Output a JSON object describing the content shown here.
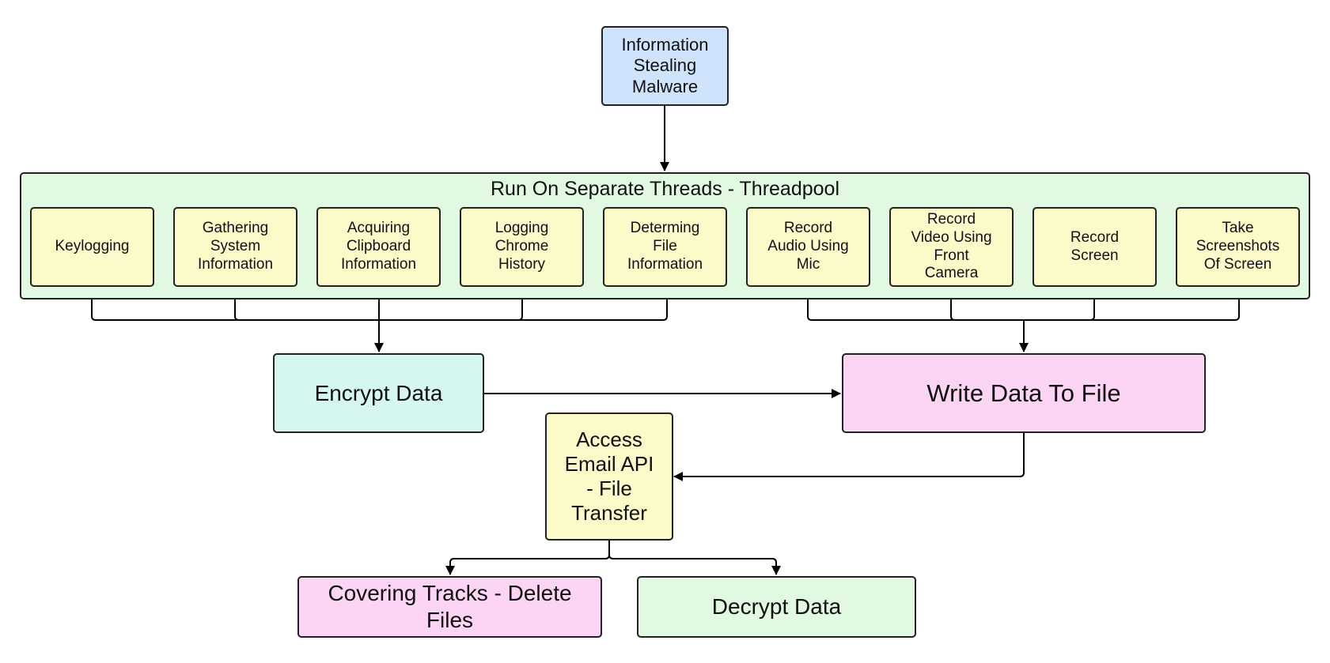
{
  "diagram": {
    "root": {
      "label": "Information\nStealing\nMalware",
      "color": "#cfe3fc"
    },
    "threadpool": {
      "title": "Run On Separate Threads - Threadpool",
      "color": "#e1f9e0",
      "tasks": [
        {
          "label": "Keylogging",
          "target": "encrypt"
        },
        {
          "label": "Gathering\nSystem\nInformation",
          "target": "encrypt"
        },
        {
          "label": "Acquiring\nClipboard\nInformation",
          "target": "encrypt"
        },
        {
          "label": "Logging\nChrome\nHistory",
          "target": "encrypt"
        },
        {
          "label": "Determing\nFile\nInformation",
          "target": "encrypt"
        },
        {
          "label": "Record\nAudio Using\nMic",
          "target": "write"
        },
        {
          "label": "Record\nVideo Using\nFront\nCamera",
          "target": "write"
        },
        {
          "label": "Record\nScreen",
          "target": "write"
        },
        {
          "label": "Take\nScreenshots\nOf Screen",
          "target": "write"
        }
      ],
      "task_color": "#fbfac8"
    },
    "encrypt": {
      "label": "Encrypt Data",
      "color": "#d6f7f1"
    },
    "write": {
      "label": "Write Data To File",
      "color": "#fdd5f4"
    },
    "email": {
      "label": "Access\nEmail API\n- File\nTransfer",
      "color": "#fbfac8"
    },
    "covering": {
      "label": "Covering Tracks - Delete\nFiles",
      "color": "#fdd5f4"
    },
    "decrypt": {
      "label": "Decrypt Data",
      "color": "#e1f9e0"
    },
    "edges": [
      {
        "from": "root",
        "to": "threadpool"
      },
      {
        "from": "tasks[0-4]",
        "to": "encrypt"
      },
      {
        "from": "tasks[5-8]",
        "to": "write"
      },
      {
        "from": "encrypt",
        "to": "write"
      },
      {
        "from": "write",
        "to": "email"
      },
      {
        "from": "email",
        "to": "covering"
      },
      {
        "from": "email",
        "to": "decrypt"
      }
    ]
  }
}
